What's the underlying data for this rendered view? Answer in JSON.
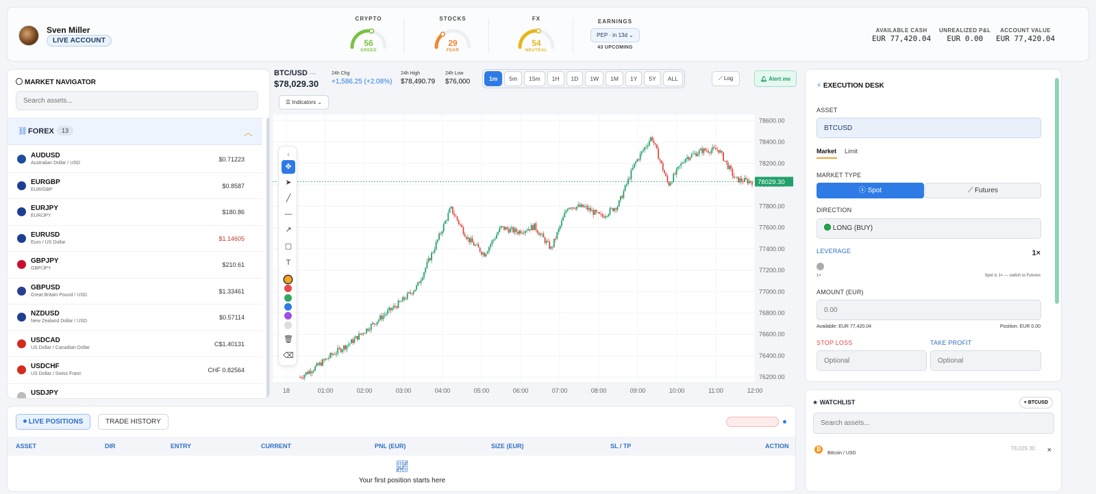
{
  "user": {
    "name": "Sven Miller",
    "account_type": "LIVE ACCOUNT"
  },
  "gauges": [
    {
      "title": "CRYPTO",
      "value": "56",
      "label": "GREED",
      "color": "#7ac142",
      "level": 56
    },
    {
      "title": "STOCKS",
      "value": "29",
      "label": "FEAR",
      "color": "#f0862b",
      "level": 29
    },
    {
      "title": "FX",
      "value": "54",
      "label": "NEUTRAL",
      "color": "#e8b51a",
      "level": 54
    }
  ],
  "earnings": {
    "title": "EARNINGS",
    "button": "PEP · in 13d ⌄",
    "sub": "43 UPCOMING"
  },
  "account": {
    "cash_label": "AVAILABLE CASH",
    "cash": "EUR 77,420.04",
    "pnl_label": "UNREALIZED P&L",
    "pnl": "EUR 0.00",
    "value_label": "ACCOUNT VALUE",
    "value": "EUR 77,420.04"
  },
  "navigator": {
    "title": "MARKET NAVIGATOR",
    "search_placeholder": "Search assets...",
    "group": "FOREX",
    "group_count": "13",
    "items": [
      {
        "symbol": "AUDUSD",
        "desc": "Australian Dollar / USD",
        "price": "$0.71223",
        "color": "#1d4e9c",
        "down": false
      },
      {
        "symbol": "EURGBP",
        "desc": "EUR/GBP",
        "price": "$0.8587",
        "color": "#1c3f94",
        "down": false
      },
      {
        "symbol": "EURJPY",
        "desc": "EUR/JPY",
        "price": "$180.86",
        "color": "#1c3f94",
        "down": false
      },
      {
        "symbol": "EURUSD",
        "desc": "Euro / US Dollar",
        "price": "$1.14605",
        "color": "#1c3f94",
        "down": true
      },
      {
        "symbol": "GBPJPY",
        "desc": "GBP/JPY",
        "price": "$210.61",
        "color": "#c8102e",
        "down": false
      },
      {
        "symbol": "GBPUSD",
        "desc": "Great Britain Pound / USD",
        "price": "$1.33461",
        "color": "#2a3f8f",
        "down": false
      },
      {
        "symbol": "NZDUSD",
        "desc": "New Zealand Dollar / USD",
        "price": "$0.57114",
        "color": "#1f3f8f",
        "down": false
      },
      {
        "symbol": "USDCAD",
        "desc": "US Dollar / Canadian Dollar",
        "price": "C$1.40131",
        "color": "#d52b1e",
        "down": false
      },
      {
        "symbol": "USDCHF",
        "desc": "US Dollar / Swiss Franc",
        "price": "CHF 0.82564",
        "color": "#d52b1e",
        "down": false
      },
      {
        "symbol": "USDJPY",
        "desc": "",
        "price": "",
        "color": "#bbbbbb",
        "down": false
      }
    ]
  },
  "ticker": {
    "symbol": "BTC/USD",
    "dash": "—",
    "price": "$78,029.30",
    "chg_label": "24h Chg",
    "chg": "+1,586.25 (+2.08%)",
    "high_label": "24h High",
    "high": "$78,490.79",
    "low_label": "24h Low",
    "low": "$76,000"
  },
  "timeframes": [
    "1m",
    "5m",
    "15m",
    "1H",
    "1D",
    "1W",
    "1M",
    "1Y",
    "5Y",
    "ALL"
  ],
  "active_timeframe": "1m",
  "chart_controls": {
    "log": "Log",
    "alert": "Alert me",
    "indicators": "Indicators"
  },
  "chart_data": {
    "type": "line",
    "title": "",
    "series": [
      {
        "values": [
          76200,
          76300,
          76420,
          76520,
          76650,
          76780,
          76900,
          77050,
          77400,
          77780,
          77500,
          77350,
          77600,
          77560,
          77610,
          77400,
          77800,
          77790,
          77700,
          77810,
          78200,
          78450,
          78000,
          78250,
          78320,
          78330,
          78050,
          78029.3
        ]
      }
    ],
    "x_tick_labels": [
      "18",
      "01:00",
      "02:00",
      "03:00",
      "04:00",
      "05:00",
      "06:00",
      "07:00",
      "08:00",
      "09:00",
      "10:00",
      "11:00",
      "12:00"
    ],
    "y_ticks": [
      78600,
      78400,
      78200,
      78000,
      77800,
      77600,
      77400,
      77200,
      77000,
      76800,
      76600,
      76400,
      76200
    ],
    "y_tick_labels": [
      "78600.00",
      "78400.00",
      "78200.00",
      "78000.00",
      "77800.00",
      "77600.00",
      "77400.00",
      "77200.00",
      "77000.00",
      "76800.00",
      "76600.00",
      "76400.00",
      "76200.00"
    ],
    "ylim": [
      76150,
      78660
    ],
    "last_price": 78029.3,
    "last_price_label": "78029.30",
    "up_color": "#22a06b",
    "down_color": "#e0483f"
  },
  "tool_colors": [
    "#f5a623",
    "#e34b4b",
    "#2ea862",
    "#2f7be6",
    "#9b51e0",
    "#dddddd"
  ],
  "execution": {
    "title": "EXECUTION DESK",
    "asset_label": "ASSET",
    "asset": "BTCUSD",
    "tab_market": "Market",
    "tab_limit": "Limit",
    "market_type_label": "MARKET TYPE",
    "spot": "Spot",
    "futures": "Futures",
    "direction_label": "DIRECTION",
    "direction": "LONG (BUY)",
    "leverage_label": "LEVERAGE",
    "leverage": "1×",
    "leverage_min": "1×",
    "leverage_note": "Spot is 1× — switch to Futures",
    "amount_label": "AMOUNT (EUR)",
    "amount_placeholder": "0.00",
    "available": "Available: EUR 77,420.04",
    "position": "Position: EUR 0.00",
    "stop_loss_label": "STOP LOSS",
    "take_profit_label": "TAKE PROFIT",
    "optional": "Optional"
  },
  "watchlist": {
    "title": "WATCHLIST",
    "add_button": "+ BTCUSD",
    "search_placeholder": "Search assets...",
    "items": [
      {
        "name": "Bitcoin / USD",
        "price": "78,029.30",
        "remove": "×"
      }
    ]
  },
  "positions": {
    "tab_live": "LIVE POSITIONS",
    "tab_history": "TRADE HISTORY",
    "columns": [
      "ASSET",
      "DIR",
      "ENTRY",
      "CURRENT",
      "PNL (EUR)",
      "SIZE (EUR)",
      "SL / TP",
      "ACTION"
    ],
    "empty_text": "Your first position starts here"
  }
}
